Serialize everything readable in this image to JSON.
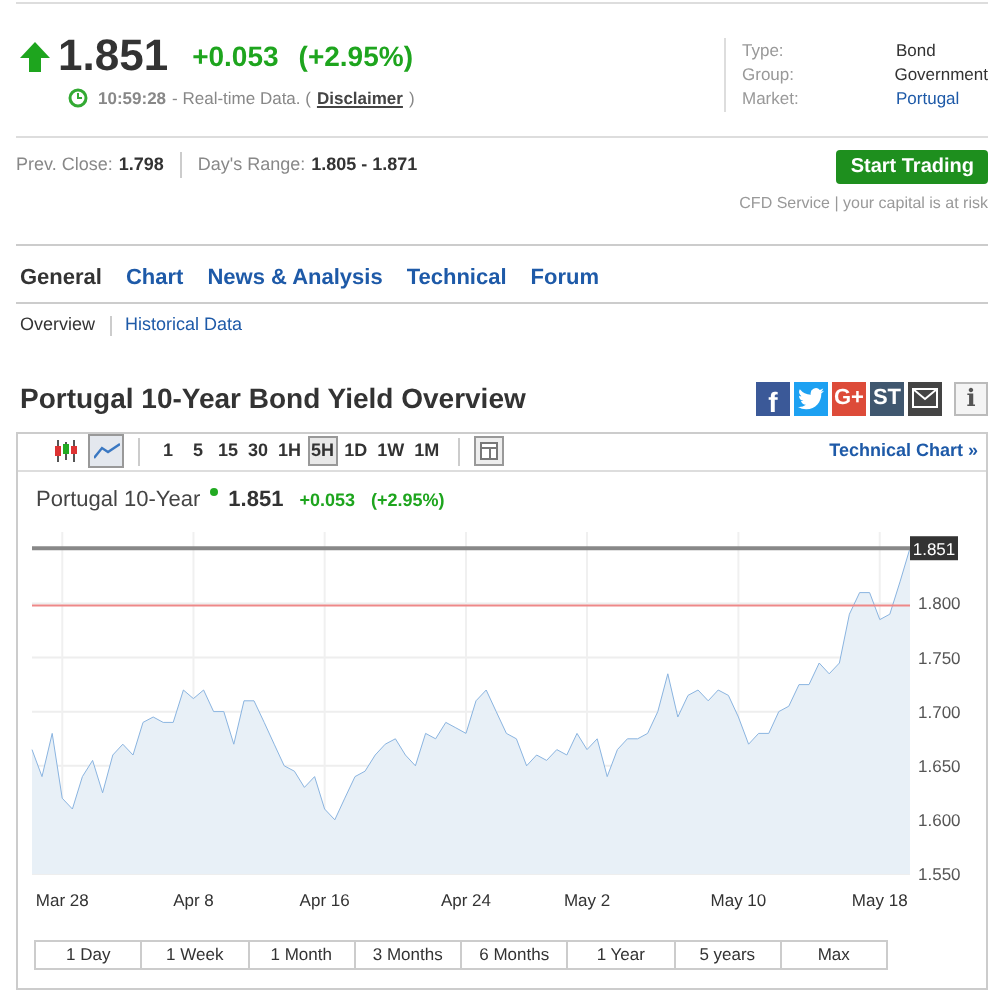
{
  "quote": {
    "rising": true,
    "price": "1.851",
    "change": "+0.053",
    "change_pct": "(+2.95%)",
    "time": "10:59:28",
    "note": "- Real-time Data. (",
    "disclaimer": "Disclaimer",
    "note_end": ")"
  },
  "info": [
    {
      "label": "Type:",
      "value": "Bond",
      "link": false
    },
    {
      "label": "Group:",
      "value": "Government",
      "link": false
    },
    {
      "label": "Market:",
      "value": "Portugal",
      "link": true
    }
  ],
  "stats": [
    {
      "label": "Prev. Close:",
      "value": "1.798"
    },
    {
      "label": "Day's Range:",
      "value": "1.805 - 1.871"
    }
  ],
  "cta": {
    "button": "Start Trading",
    "note": "CFD Service | your capital is at risk"
  },
  "tabs": [
    {
      "label": "General",
      "selected": true
    },
    {
      "label": "Chart",
      "selected": false
    },
    {
      "label": "News & Analysis",
      "selected": false
    },
    {
      "label": "Technical",
      "selected": false
    },
    {
      "label": "Forum",
      "selected": false
    }
  ],
  "subtabs": [
    {
      "label": "Overview",
      "selected": true
    },
    {
      "label": "Historical Data",
      "selected": false
    }
  ],
  "title": "Portugal 10-Year Bond Yield Overview",
  "share": [
    {
      "kind": "facebook",
      "label": "f"
    },
    {
      "kind": "twitter"
    },
    {
      "kind": "googleplus",
      "label": "G+"
    },
    {
      "kind": "stocktwits",
      "label": "ST"
    },
    {
      "kind": "email"
    },
    {
      "kind": "info",
      "label": "i"
    }
  ],
  "toolbar": {
    "chart_types": [
      {
        "kind": "candles",
        "selected": false
      },
      {
        "kind": "line",
        "selected": true
      }
    ],
    "intervals": [
      {
        "label": "1",
        "selected": false
      },
      {
        "label": "5",
        "selected": false
      },
      {
        "label": "15",
        "selected": false
      },
      {
        "label": "30",
        "selected": false
      },
      {
        "label": "1H",
        "selected": false
      },
      {
        "label": "5H",
        "selected": true
      },
      {
        "label": "1D",
        "selected": false
      },
      {
        "label": "1W",
        "selected": false
      },
      {
        "label": "1M",
        "selected": false
      }
    ],
    "technical_link": "Technical Chart »"
  },
  "chart": {
    "price": "1.851",
    "change": "+0.053",
    "change_pct": "(+2.95%)",
    "chart_data": {
      "type": "area",
      "grid": true,
      "ylim": [
        1.55,
        1.866
      ],
      "categories": [
        null,
        null,
        null,
        "Mar 28",
        null,
        null,
        null,
        null,
        null,
        null,
        null,
        null,
        null,
        null,
        null,
        null,
        "Apr 8",
        null,
        null,
        null,
        null,
        null,
        null,
        null,
        null,
        null,
        null,
        null,
        null,
        "Apr 16",
        null,
        null,
        null,
        null,
        null,
        null,
        null,
        null,
        null,
        null,
        null,
        null,
        null,
        "Apr 24",
        null,
        null,
        null,
        null,
        null,
        null,
        null,
        null,
        null,
        null,
        null,
        "May 2",
        null,
        null,
        null,
        null,
        null,
        null,
        null,
        null,
        null,
        null,
        null,
        null,
        null,
        null,
        "May 10",
        null,
        null,
        null,
        null,
        null,
        null,
        null,
        null,
        null,
        null,
        null,
        null,
        null,
        "May 18",
        null,
        null,
        null
      ],
      "series": [
        {
          "name": "Portugal 10-Year",
          "color": "#8ab4e0",
          "values": [
            1.665,
            1.64,
            1.68,
            1.62,
            1.61,
            1.64,
            1.655,
            1.625,
            1.66,
            1.67,
            1.66,
            1.69,
            1.695,
            1.69,
            1.69,
            1.72,
            1.712,
            1.72,
            1.7,
            1.7,
            1.67,
            1.71,
            1.71,
            1.69,
            1.67,
            1.65,
            1.645,
            1.63,
            1.64,
            1.61,
            1.6,
            1.62,
            1.64,
            1.645,
            1.66,
            1.67,
            1.675,
            1.66,
            1.65,
            1.68,
            1.675,
            1.69,
            1.685,
            1.68,
            1.71,
            1.72,
            1.7,
            1.68,
            1.675,
            1.65,
            1.66,
            1.655,
            1.665,
            1.66,
            1.68,
            1.665,
            1.675,
            1.64,
            1.665,
            1.675,
            1.675,
            1.68,
            1.7,
            1.735,
            1.695,
            1.715,
            1.72,
            1.71,
            1.72,
            1.715,
            1.695,
            1.67,
            1.68,
            1.68,
            1.7,
            1.705,
            1.725,
            1.725,
            1.745,
            1.735,
            1.745,
            1.79,
            1.81,
            1.81,
            1.785,
            1.79,
            1.82,
            1.851
          ]
        }
      ],
      "yticks": [
        {
          "value": 1.55,
          "label": "1.550"
        },
        {
          "value": 1.6,
          "label": "1.600"
        },
        {
          "value": 1.65,
          "label": "1.650"
        },
        {
          "value": 1.7,
          "label": "1.700"
        },
        {
          "value": 1.75,
          "label": "1.750"
        },
        {
          "value": 1.8,
          "label": "1.800"
        }
      ],
      "ref_lines": [
        {
          "axis": "y",
          "value": 1.851,
          "label": "1.851",
          "color": "#888888"
        },
        {
          "axis": "y",
          "value": 1.798,
          "color": "#ee8888"
        }
      ]
    }
  },
  "ranges": [
    "1 Day",
    "1 Week",
    "1 Month",
    "3 Months",
    "6 Months",
    "1 Year",
    "5 years",
    "Max"
  ]
}
